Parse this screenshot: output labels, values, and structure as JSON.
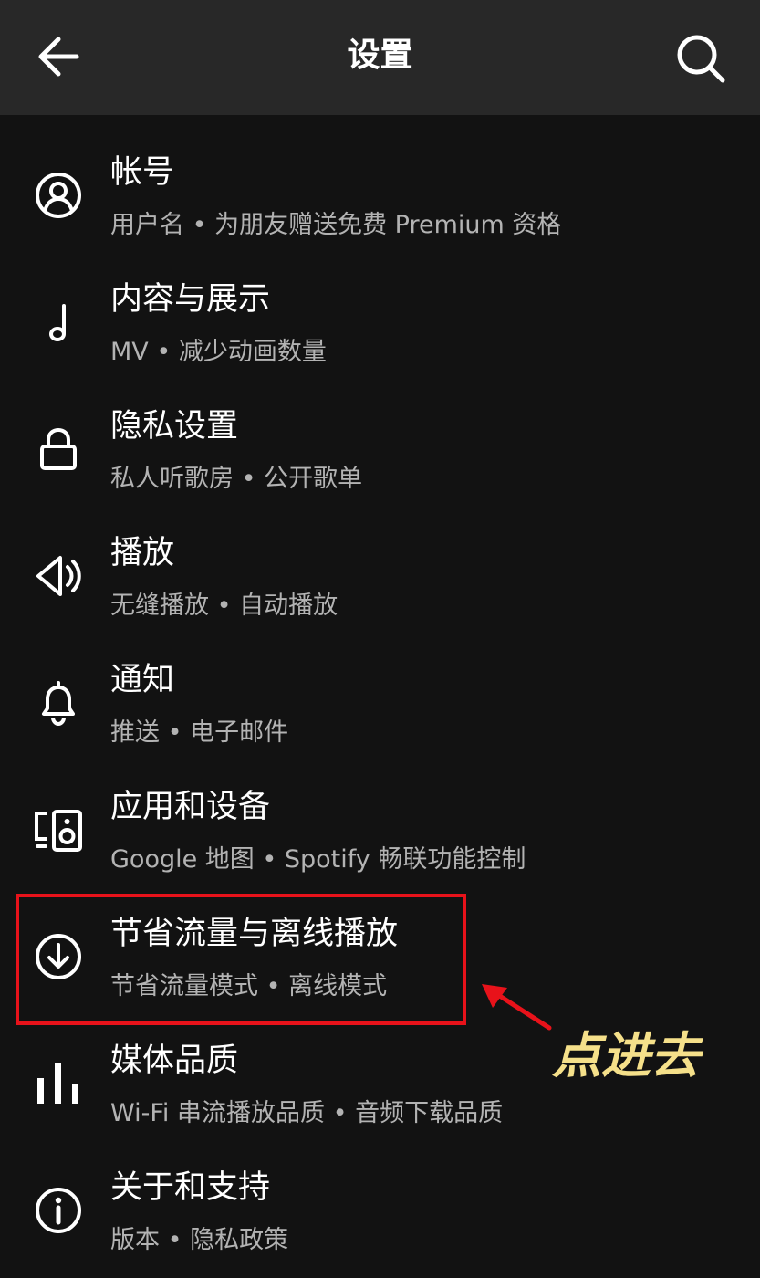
{
  "header": {
    "title": "设置",
    "back_icon": "arrow-left-icon",
    "search_icon": "search-icon"
  },
  "items": [
    {
      "icon": "account-icon",
      "title": "帐号",
      "subtitle": "用户名 • 为朋友赠送免费 Premium 资格"
    },
    {
      "icon": "music-note-icon",
      "title": "内容与展示",
      "subtitle": "MV • 减少动画数量"
    },
    {
      "icon": "lock-icon",
      "title": "隐私设置",
      "subtitle": "私人听歌房 • 公开歌单"
    },
    {
      "icon": "speaker-icon",
      "title": "播放",
      "subtitle": "无缝播放 • 自动播放"
    },
    {
      "icon": "bell-icon",
      "title": "通知",
      "subtitle": "推送 • 电子邮件"
    },
    {
      "icon": "devices-icon",
      "title": "应用和设备",
      "subtitle": "Google 地图 • Spotify 畅联功能控制"
    },
    {
      "icon": "download-icon",
      "title": "节省流量与离线播放",
      "subtitle": "节省流量模式 • 离线模式"
    },
    {
      "icon": "bars-icon",
      "title": "媒体品质",
      "subtitle": "Wi-Fi 串流播放品质 • 音频下载品质"
    },
    {
      "icon": "info-icon",
      "title": "关于和支持",
      "subtitle": "版本 • 隐私政策"
    }
  ],
  "annotation": {
    "text": "点进去",
    "color": "#f5e08a",
    "box_color": "#e8121a"
  },
  "colors": {
    "background": "#121212",
    "header": "#282828",
    "subtitle": "#b3b3b3"
  }
}
